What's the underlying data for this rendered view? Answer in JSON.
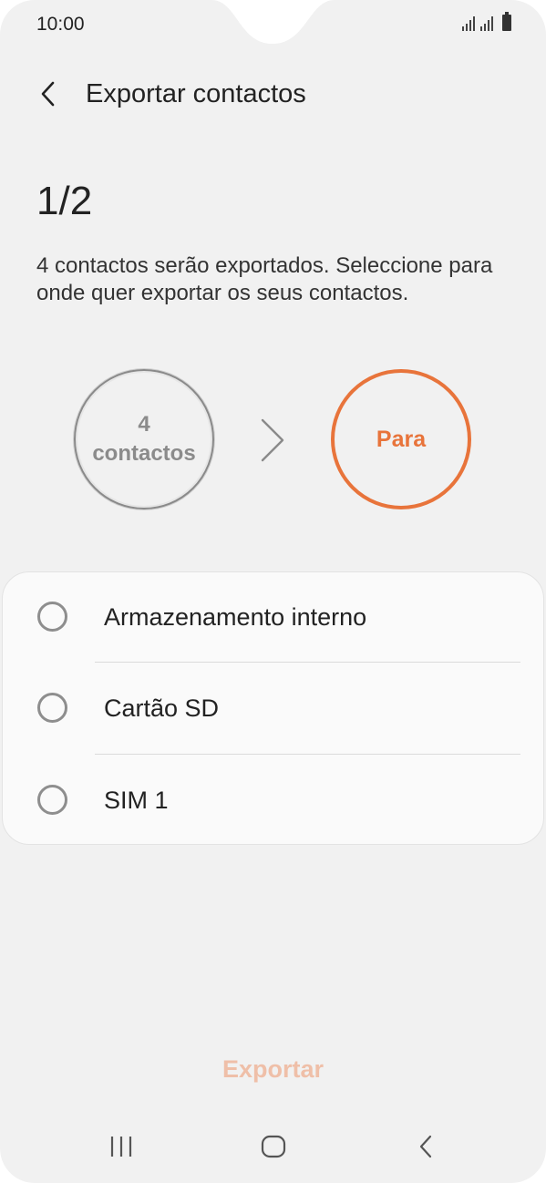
{
  "status": {
    "time": "10:00",
    "icons": [
      "signal-icon",
      "signal-icon",
      "battery-icon"
    ]
  },
  "header": {
    "back_icon": "chevron-left-icon",
    "title": "Exportar contactos"
  },
  "step": "1/2",
  "description": "4 contactos serão exportados. Seleccione para onde quer exportar os seus contactos.",
  "flow": {
    "from_count": "4",
    "from_label": "contactos",
    "arrow_icon": "chevron-right-icon",
    "to_label": "Para",
    "accent_color": "#e8743b"
  },
  "options": [
    {
      "label": "Armazenamento interno",
      "selected": false
    },
    {
      "label": "Cartão SD",
      "selected": false
    },
    {
      "label": "SIM 1",
      "selected": false
    }
  ],
  "export_label": "Exportar",
  "navbar": {
    "recent_icon": "recent-apps-icon",
    "home_icon": "home-icon",
    "back_icon": "back-icon"
  }
}
